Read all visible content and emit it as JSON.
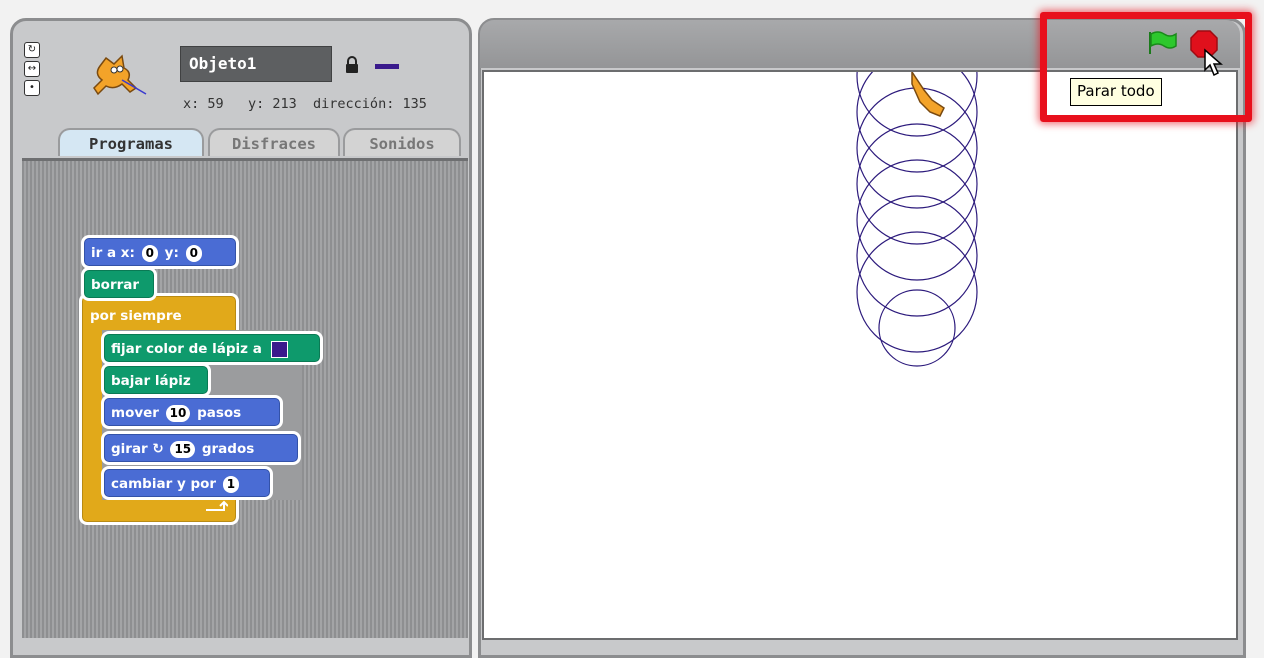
{
  "sprite": {
    "name": "Objeto1",
    "info": "x: 59   y: 213  dirección: 135",
    "pen_color": "#3a1a8c"
  },
  "tabs": [
    {
      "label": "Programas",
      "active": true
    },
    {
      "label": "Disfraces",
      "active": false
    },
    {
      "label": "Sonidos",
      "active": false
    }
  ],
  "script": {
    "goto_label_a": "ir a x:",
    "goto_x": "0",
    "goto_label_b": "y:",
    "goto_y": "0",
    "clear_label": "borrar",
    "forever_label": "por siempre",
    "set_pen_label": "fijar color de lápiz a",
    "pen_down_label": "bajar lápiz",
    "move_label_a": "mover",
    "move_steps": "10",
    "move_label_b": "pasos",
    "turn_label_a": "girar",
    "turn_degrees": "15",
    "turn_label_b": "grados",
    "change_y_label": "cambiar y por",
    "change_y_value": "1"
  },
  "stage": {
    "tooltip": "Parar todo",
    "flag_color": "#2dc82d",
    "stop_color": "#e0101c",
    "highlight_color": "#e8101c"
  }
}
